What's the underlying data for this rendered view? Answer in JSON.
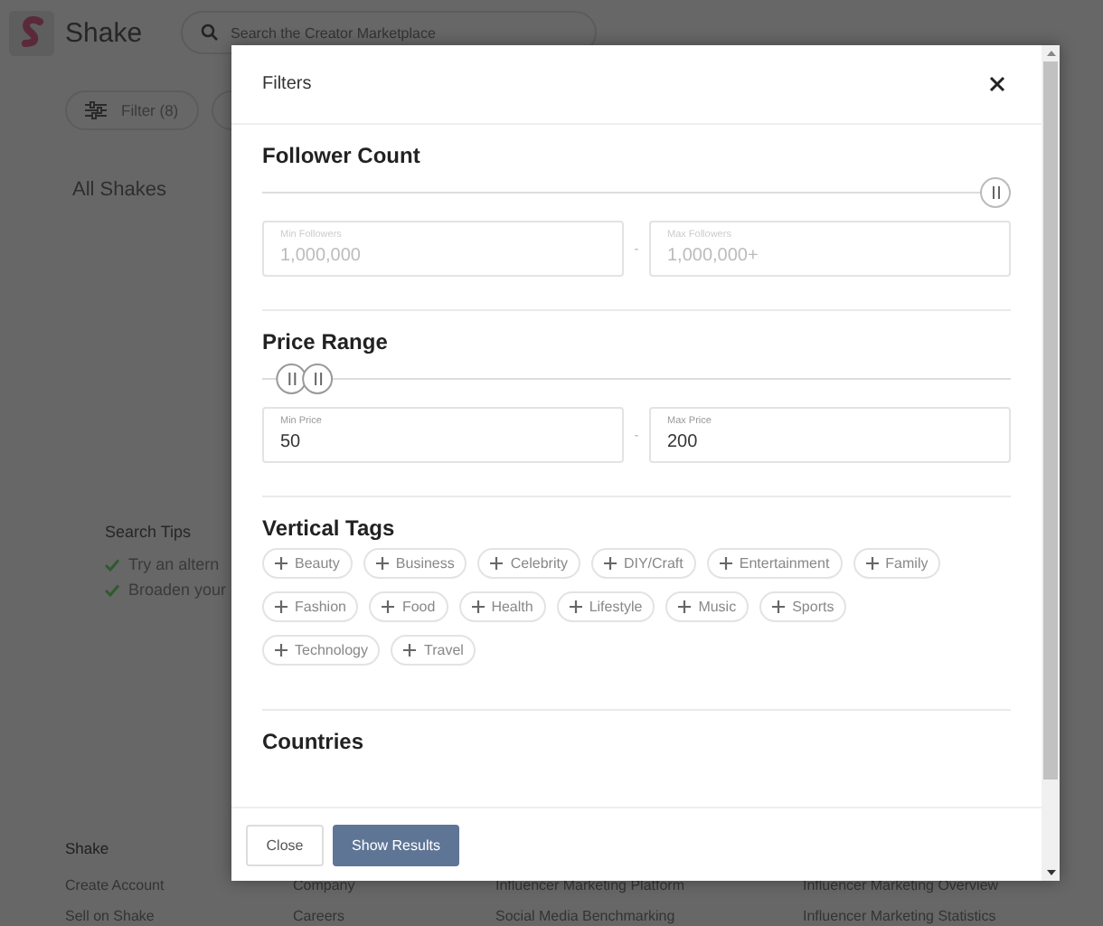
{
  "header": {
    "brand": "Shake",
    "search": {
      "placeholder": "Search the Creator Marketplace"
    }
  },
  "toolbar": {
    "filter_button": "Filter (8)"
  },
  "page_title": "All Shakes",
  "search_tips": {
    "title": "Search Tips",
    "tips": [
      "Try an altern",
      "Broaden your"
    ]
  },
  "footer": {
    "columns": [
      {
        "heading": "Shake",
        "links": [
          "Create Account",
          "Sell on Shake"
        ]
      },
      {
        "links": [
          "Company",
          "Careers"
        ]
      },
      {
        "links": [
          "Influencer Marketing Platform",
          "Social Media Benchmarking"
        ]
      },
      {
        "links": [
          "Influencer Marketing Overview",
          "Influencer Marketing Statistics"
        ]
      }
    ]
  },
  "modal": {
    "title": "Filters",
    "sections": [
      {
        "kind": "range",
        "title": "Follower Count",
        "disabled": true,
        "separator": "-",
        "thumbs": [
          {
            "level": 1
          }
        ],
        "fields": [
          {
            "label": "Min Followers",
            "value": "1,000,000"
          },
          {
            "label": "Max Followers",
            "value": "1,000,000+"
          }
        ]
      },
      {
        "kind": "range",
        "title": "Price Range",
        "disabled": false,
        "separator": "-",
        "thumbs": [
          {
            "level": 0.02
          },
          {
            "level": 0.055
          }
        ],
        "fields": [
          {
            "label": "Min Price",
            "value": "50"
          },
          {
            "label": "Max Price",
            "value": "200"
          }
        ]
      },
      {
        "kind": "tags",
        "title": "Vertical Tags",
        "tags": [
          {
            "label": "Beauty",
            "selected": false
          },
          {
            "label": "Business",
            "selected": false
          },
          {
            "label": "Celebrity",
            "selected": false
          },
          {
            "label": "DIY/Craft",
            "selected": false
          },
          {
            "label": "Entertainment",
            "selected": false
          },
          {
            "label": "Family",
            "selected": false
          },
          {
            "label": "Fashion",
            "selected": false
          },
          {
            "label": "Food",
            "selected": false
          },
          {
            "label": "Health",
            "selected": false
          },
          {
            "label": "Lifestyle",
            "selected": false
          },
          {
            "label": "Music",
            "selected": false
          },
          {
            "label": "Sports",
            "selected": false
          },
          {
            "label": "Technology",
            "selected": false
          },
          {
            "label": "Travel",
            "selected": false
          }
        ]
      },
      {
        "kind": "heading",
        "title": "Countries"
      }
    ],
    "buttons": [
      {
        "label": "Close",
        "kind": "secondary"
      },
      {
        "label": "Show Results",
        "kind": "primary"
      }
    ]
  }
}
